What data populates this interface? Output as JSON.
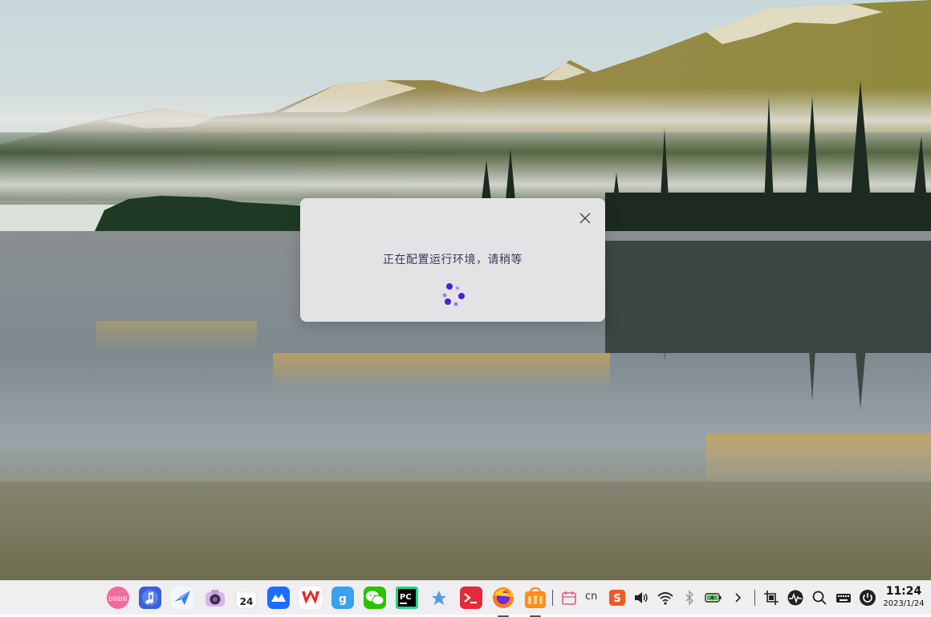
{
  "dialog": {
    "message": "正在配置运行环境，请稍等"
  },
  "taskbar": {
    "apps": [
      {
        "icon": "bilibili-icon",
        "label": "bilibili"
      },
      {
        "icon": "music-icon"
      },
      {
        "icon": "lark-icon"
      },
      {
        "icon": "camera-icon"
      },
      {
        "icon": "calendar-icon",
        "day": "24"
      },
      {
        "icon": "tencent-meeting-icon"
      },
      {
        "icon": "wps-icon"
      },
      {
        "icon": "sogou-icon"
      },
      {
        "icon": "wechat-icon"
      },
      {
        "icon": "pycharm-icon",
        "label": "PC"
      },
      {
        "icon": "kylin-icon"
      },
      {
        "icon": "terminal-icon"
      },
      {
        "icon": "firefox-icon"
      },
      {
        "icon": "software-store-icon"
      }
    ],
    "tray": {
      "input_method": "cn",
      "clock_time": "11:24",
      "clock_date": "2023/1/24"
    }
  },
  "colors": {
    "taskbar_bg": "#eeeef0",
    "dialog_bg": "#e3e3e5",
    "spinner": "#4b1fd6",
    "message_text": "#3a3a58"
  }
}
